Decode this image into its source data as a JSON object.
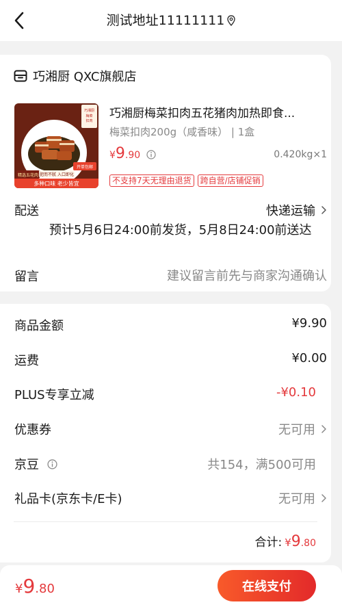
{
  "header": {
    "title": "测试地址11111111"
  },
  "shop": {
    "name": "巧湘厨 QXC旗舰店"
  },
  "product": {
    "title": "巧湘厨梅菜扣肉五花猪肉加热即食...",
    "spec": "梅菜扣肉200g（咸香味） | 1盒",
    "price": {
      "currency": "¥",
      "integer": "9",
      "decimal": ".90"
    },
    "weight": "0.420kg×1",
    "tags": [
      "不支持7天无理由退货",
      "跨自营/店铺促销"
    ],
    "image": {
      "badge_top": "巧湘厨\n梅菜扣肉",
      "badge_left": "精选五花肉",
      "badge_right": "开单包邮",
      "line1": "肥而不腻 入口即化",
      "line2": "多种口味 老少皆宜"
    }
  },
  "delivery": {
    "label": "配送",
    "value": "快递运输",
    "eta": "预计5月6日24:00前发货，5月8日24:00前送达"
  },
  "remark": {
    "label": "留言",
    "placeholder": "建议留言前先与商家沟通确认"
  },
  "summary": [
    {
      "label": "商品金额",
      "value": "¥9.90"
    },
    {
      "label": "运费",
      "value": "¥0.00"
    },
    {
      "label": "PLUS专享立减",
      "value": "-¥0.10"
    },
    {
      "label": "优惠券",
      "value": "无可用"
    },
    {
      "label": "京豆",
      "value": "共154，满500可用"
    },
    {
      "label": "礼品卡(京东卡/E卡)",
      "value": "无可用"
    }
  ],
  "total": {
    "label": "合计:",
    "currency": "¥",
    "integer": "9",
    "decimal": ".80"
  },
  "bottom": {
    "currency": "¥",
    "integer": "9",
    "decimal": ".80",
    "pay_label": "在线支付"
  },
  "colors": {
    "accent": "#e4393c",
    "button_start": "#f85a2a",
    "button_end": "#e32a2a"
  }
}
